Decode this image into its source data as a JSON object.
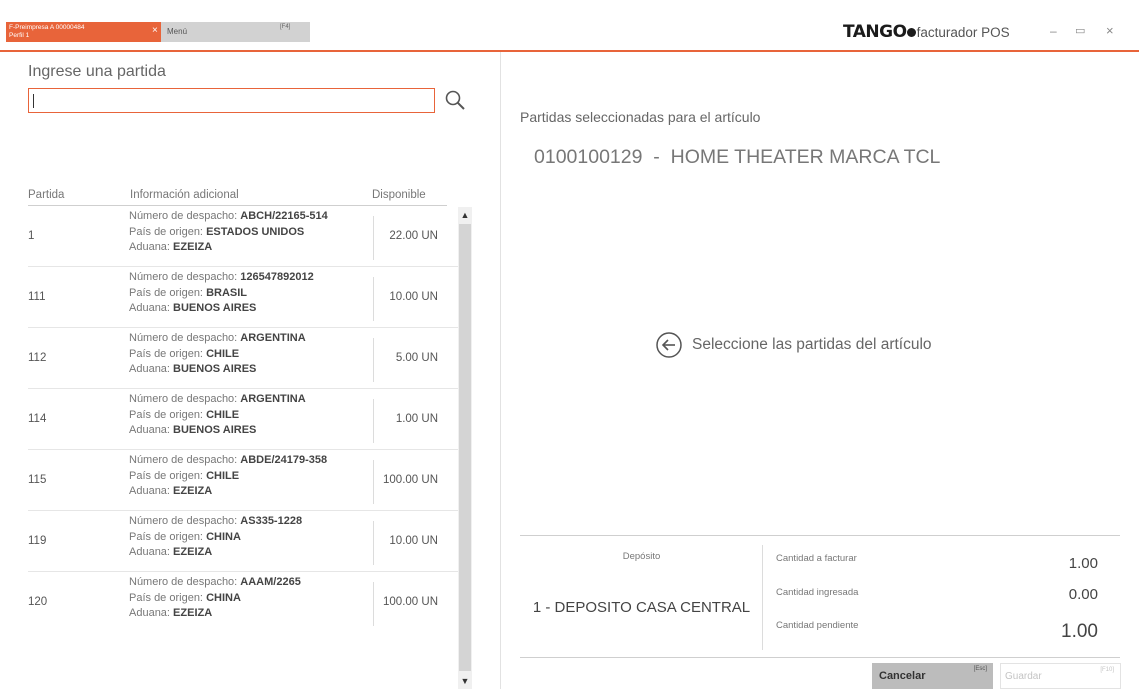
{
  "tabs": {
    "active_line1": "F-Preimpresa A 00000484",
    "active_line2": "Perfil 1",
    "active_close": "×",
    "menu_label": "Menú",
    "menu_key": "[F4]"
  },
  "brand": {
    "name": "TANGO",
    "product": "facturador POS",
    "accent_color": "#e8643a"
  },
  "window_controls": {
    "minimize": "–",
    "maximize": "▭",
    "close": "×"
  },
  "search": {
    "prompt": "Ingrese una partida",
    "value": "",
    "placeholder": ""
  },
  "table": {
    "headers": {
      "partida": "Partida",
      "info": "Información adicional",
      "disponible": "Disponible"
    },
    "labels": {
      "despacho": "Número de despacho: ",
      "origen": "País de origen: ",
      "aduana": "Aduana: "
    },
    "rows": [
      {
        "partida": "1",
        "despacho": "ABCH/22165-514",
        "origen": "ESTADOS UNIDOS",
        "aduana": "EZEIZA",
        "disponible": "22.00 UN"
      },
      {
        "partida": "111",
        "despacho": "126547892012",
        "origen": "BRASIL",
        "aduana": "BUENOS AIRES",
        "disponible": "10.00 UN"
      },
      {
        "partida": "112",
        "despacho": "ARGENTINA",
        "origen": "CHILE",
        "aduana": "BUENOS AIRES",
        "disponible": "5.00 UN"
      },
      {
        "partida": "114",
        "despacho": "ARGENTINA",
        "origen": "CHILE",
        "aduana": "BUENOS AIRES",
        "disponible": "1.00 UN"
      },
      {
        "partida": "115",
        "despacho": "ABDE/24179-358",
        "origen": "CHILE",
        "aduana": "EZEIZA",
        "disponible": "100.00 UN"
      },
      {
        "partida": "119",
        "despacho": "AS335-1228",
        "origen": "CHINA",
        "aduana": "EZEIZA",
        "disponible": "10.00 UN"
      },
      {
        "partida": "120",
        "despacho": "AAAM/2265",
        "origen": "CHINA",
        "aduana": "EZEIZA",
        "disponible": "100.00 UN"
      }
    ]
  },
  "selection": {
    "title": "Partidas seleccionadas para el artículo",
    "article": "0100100129  -  HOME THEATER MARCA TCL",
    "hint": "Seleccione las partidas del artículo"
  },
  "summary": {
    "deposito_label": "Depósito",
    "deposito_value": "1 - DEPOSITO CASA CENTRAL",
    "a_facturar_label": "Cantidad a facturar",
    "a_facturar_value": "1.00",
    "ingresada_label": "Cantidad ingresada",
    "ingresada_value": "0.00",
    "pendiente_label": "Cantidad pendiente",
    "pendiente_value": "1.00"
  },
  "actions": {
    "cancel_label": "Cancelar",
    "cancel_key": "[Esc]",
    "save_label": "Guardar",
    "save_key": "[F10]"
  }
}
